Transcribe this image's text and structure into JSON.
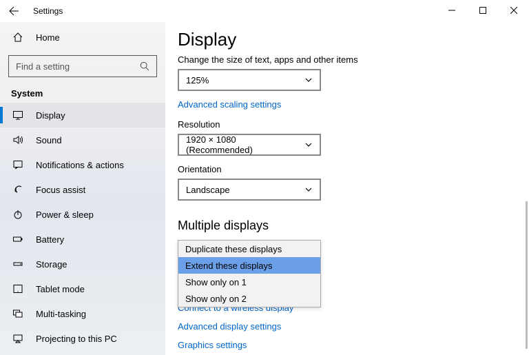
{
  "titlebar": {
    "title": "Settings"
  },
  "sidebar": {
    "home": "Home",
    "search_placeholder": "Find a setting",
    "section": "System",
    "items": [
      {
        "label": "Display",
        "selected": true
      },
      {
        "label": "Sound"
      },
      {
        "label": "Notifications & actions"
      },
      {
        "label": "Focus assist"
      },
      {
        "label": "Power & sleep"
      },
      {
        "label": "Battery"
      },
      {
        "label": "Storage"
      },
      {
        "label": "Tablet mode"
      },
      {
        "label": "Multi-tasking"
      },
      {
        "label": "Projecting to this PC"
      }
    ]
  },
  "main": {
    "heading": "Display",
    "scale_label": "Change the size of text, apps and other items",
    "scale_value": "125%",
    "adv_scaling": "Advanced scaling settings",
    "resolution_label": "Resolution",
    "resolution_value": "1920 × 1080 (Recommended)",
    "orientation_label": "Orientation",
    "orientation_value": "Landscape",
    "multiple_heading": "Multiple displays",
    "multiple_options": [
      "Duplicate these displays",
      "Extend these displays",
      "Show only on 1",
      "Show only on 2"
    ],
    "multiple_selected_index": 1,
    "connect_link": "Connect to a wireless display",
    "adv_display": "Advanced display settings",
    "graphics": "Graphics settings"
  }
}
